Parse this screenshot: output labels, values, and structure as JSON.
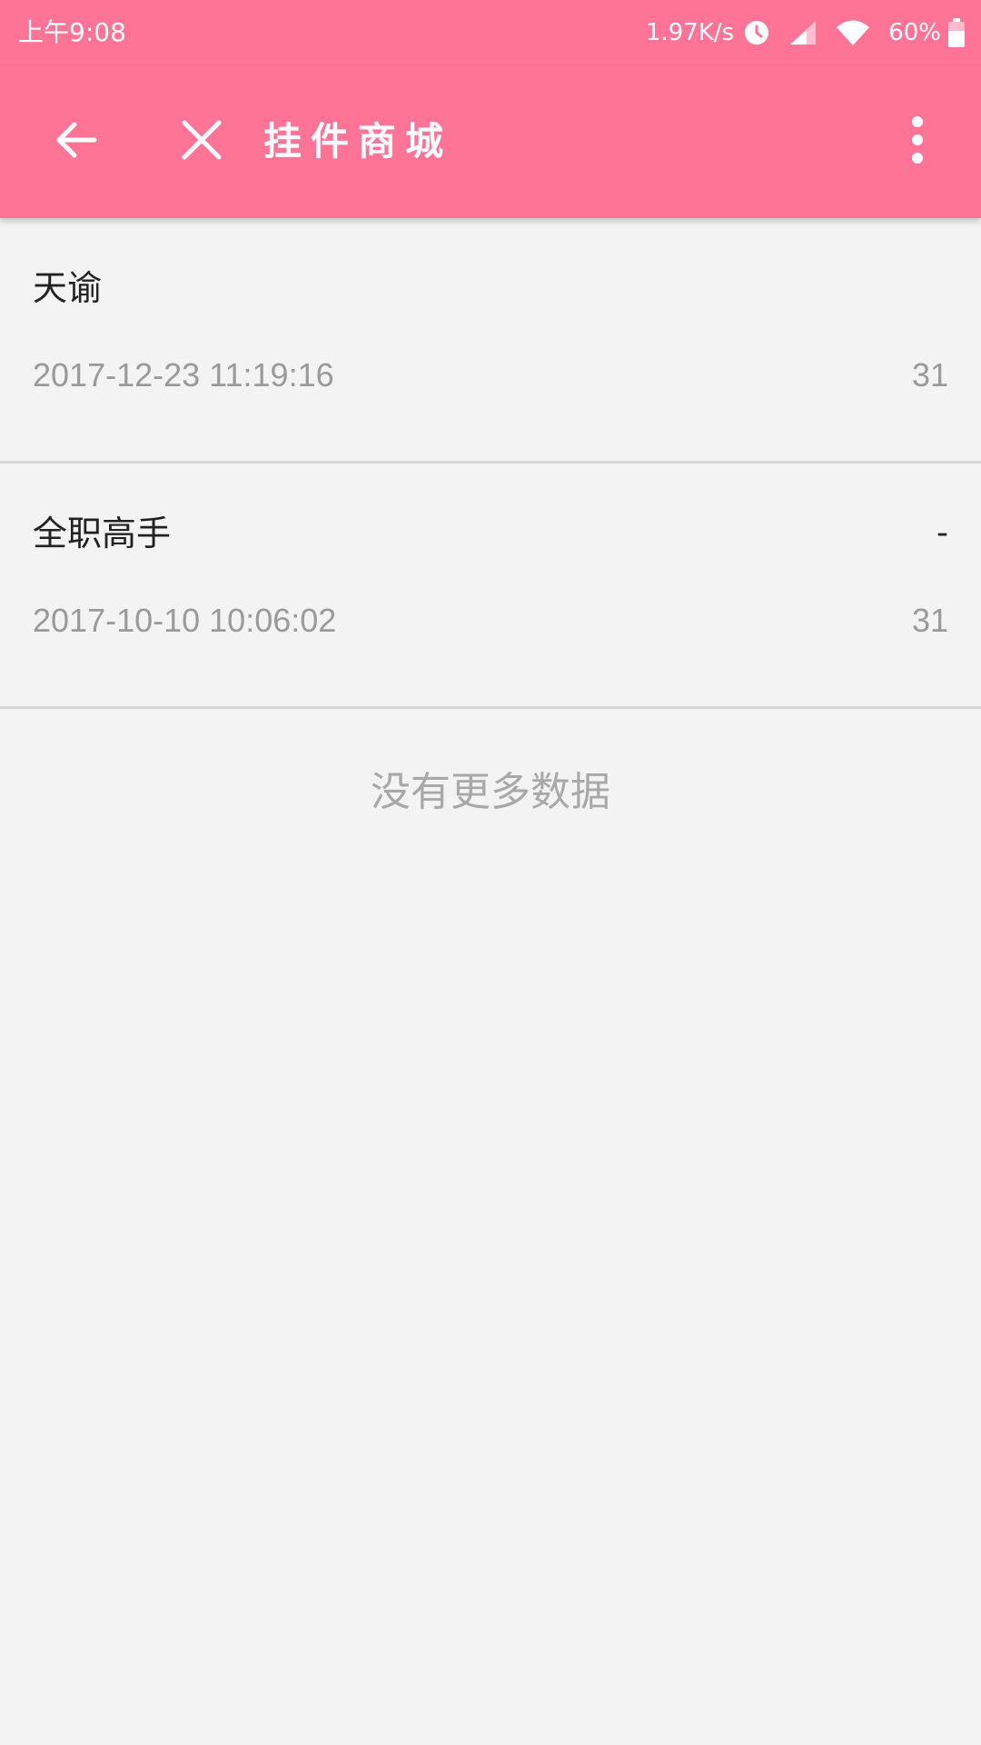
{
  "status_bar": {
    "time": "上午9:08",
    "network_speed": "1.97K/s",
    "battery": "60%",
    "icons": [
      "alarm-icon",
      "signal-icon",
      "wifi-icon",
      "battery-icon"
    ]
  },
  "app_bar": {
    "title": "挂件商城",
    "background_color": "#fd7497",
    "icons": [
      "back-arrow-icon",
      "close-icon",
      "more-vert-icon"
    ]
  },
  "list": {
    "items": [
      {
        "title": "天谕",
        "extra": "",
        "date": "2017-12-23 11:19:16",
        "count": "31"
      },
      {
        "title": "全职高手",
        "extra": "-",
        "date": "2017-10-10 10:06:02",
        "count": "31"
      }
    ],
    "footer": "没有更多数据"
  }
}
